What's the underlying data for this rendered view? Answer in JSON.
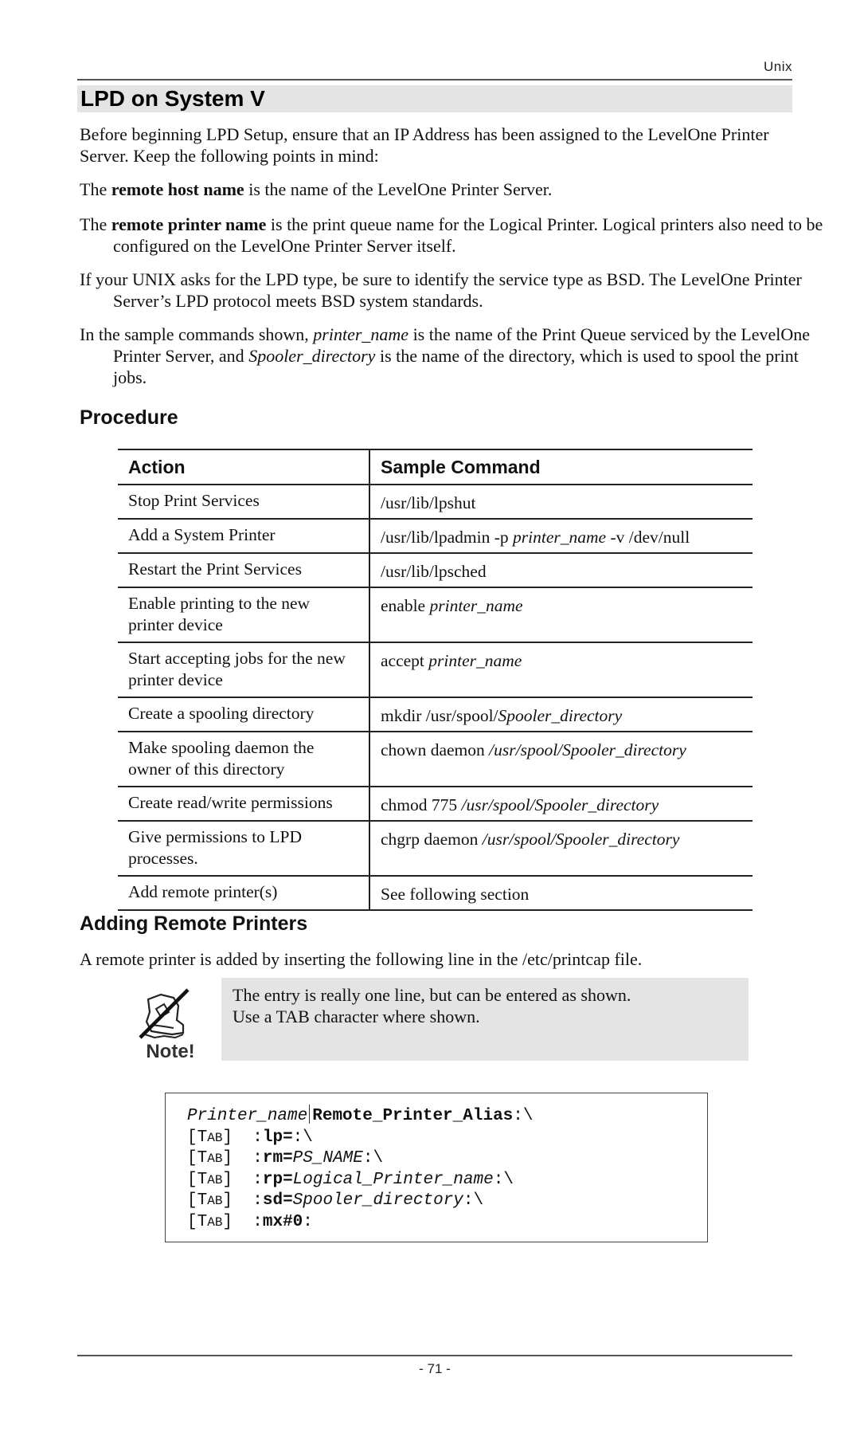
{
  "header": {
    "running_head": "Unix"
  },
  "title": "LPD on System V",
  "intro": {
    "p1": "Before beginning LPD Setup, ensure that an IP Address has been assigned to the LevelOne Printer Server. Keep the following points in mind:",
    "p2": {
      "pre": "The ",
      "bold": "remote host name",
      "post": " is the name of the LevelOne Printer Server."
    },
    "p3": {
      "pre": "The ",
      "bold": "remote printer name",
      "post": " is the print queue name for the Logical Printer. Logical printers also need to be configured on the LevelOne Printer Server itself."
    },
    "p4": "If your UNIX asks for the LPD type, be sure to identify the service type as BSD. The LevelOne Printer Server’s LPD protocol meets BSD system standards.",
    "p5": {
      "a": "In the sample commands shown, ",
      "i1": "printer_name",
      "b": " is the name of the Print Queue serviced by the LevelOne Printer Server, and ",
      "i2": "Spooler_directory",
      "c": " is the name of the directory, which is used to spool the print jobs."
    }
  },
  "procedure": {
    "heading": "Procedure",
    "columns": [
      "Action",
      "Sample Command"
    ],
    "rows": [
      {
        "action": "Stop Print Services",
        "cmd_plain": "/usr/lib/lpshut",
        "cmd_italic": "",
        "cmd_tail": ""
      },
      {
        "action": "Add a System Printer",
        "cmd_plain": "/usr/lib/lpadmin -p ",
        "cmd_italic": "printer_name",
        "cmd_tail": " -v /dev/null"
      },
      {
        "action": "Restart the Print Services",
        "cmd_plain": "/usr/lib/lpsched",
        "cmd_italic": "",
        "cmd_tail": ""
      },
      {
        "action": "Enable printing to the new printer device",
        "cmd_plain": "enable ",
        "cmd_italic": "printer_name",
        "cmd_tail": ""
      },
      {
        "action": "Start accepting jobs for the new printer device",
        "cmd_plain": "accept ",
        "cmd_italic": "printer_name",
        "cmd_tail": ""
      },
      {
        "action": "Create a spooling directory",
        "cmd_plain": "mkdir /usr/spool/",
        "cmd_italic": "Spooler_directory",
        "cmd_tail": ""
      },
      {
        "action": "Make spooling daemon the owner of this directory",
        "cmd_plain": "chown daemon ",
        "cmd_italic": "/usr/spool/Spooler_directory",
        "cmd_tail": ""
      },
      {
        "action": "Create read/write permissions",
        "cmd_plain": "chmod 775 ",
        "cmd_italic": "/usr/spool/Spooler_directory",
        "cmd_tail": ""
      },
      {
        "action": "Give permissions to LPD processes.",
        "cmd_plain": "chgrp daemon ",
        "cmd_italic": "/usr/spool/Spooler_directory",
        "cmd_tail": ""
      },
      {
        "action": "Add remote printer(s)",
        "cmd_plain": "See following section",
        "cmd_italic": "",
        "cmd_tail": ""
      }
    ]
  },
  "remote": {
    "heading": "Adding Remote Printers",
    "intro": "A remote printer is added by inserting the following line in the /etc/printcap file.",
    "note_label": "Note!",
    "note_icon": "note-hand-pen-icon",
    "note_line1": "The entry is really one line, but can be entered as shown.",
    "note_line2": "Use a TAB character where shown."
  },
  "code": {
    "line1_italic": "Printer_name",
    "line1_bold": "Remote_Printer_Alias",
    "line1_tail": ":\\",
    "tab_label_T": "[T",
    "tab_label_AB": "AB",
    "tab_label_end": "]",
    "lines": [
      {
        "colon": ":",
        "key": "lp=",
        "val": "",
        "tail": ":\\"
      },
      {
        "colon": ":",
        "key": "rm=",
        "val": "PS_NAME",
        "tail": ":\\"
      },
      {
        "colon": ":",
        "key": "rp=",
        "val": "Logical_Printer_name",
        "tail": ":\\"
      },
      {
        "colon": ":",
        "key": "sd=",
        "val": "Spooler_directory",
        "tail": ":\\"
      },
      {
        "colon": ":",
        "key": "mx#0",
        "val": "",
        "tail": ":"
      }
    ]
  },
  "footer": {
    "page_number": "- 71 -"
  }
}
